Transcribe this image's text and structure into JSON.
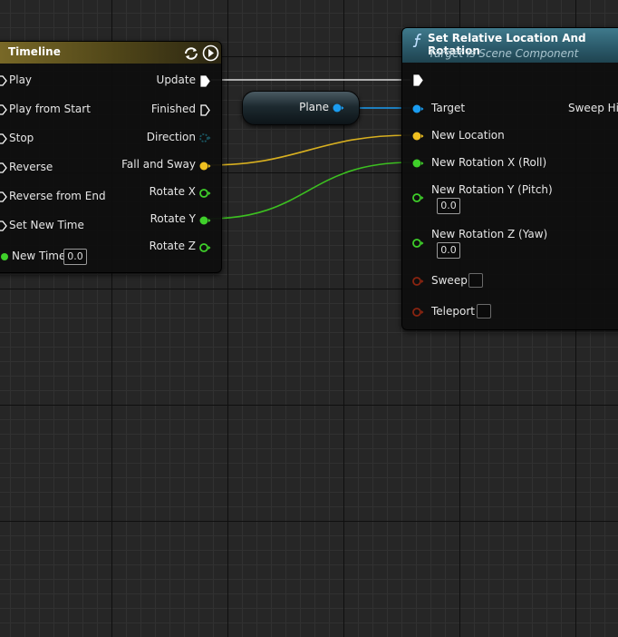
{
  "timeline": {
    "title": "Timeline",
    "inputs": [
      "Play",
      "Play from Start",
      "Stop",
      "Reverse",
      "Reverse from End",
      "Set New Time",
      "New Time"
    ],
    "new_time_value": "0.0",
    "outputs": [
      "Update",
      "Finished",
      "Direction",
      "Fall and Sway",
      "Rotate X",
      "Rotate Y",
      "Rotate Z"
    ],
    "header_color": "#6b5a1e"
  },
  "plane_node": {
    "label": "Plane"
  },
  "set_node": {
    "title": "Set Relative Location And Rotation",
    "subtitle": "Target is Scene Component",
    "function_icon": "function-icon",
    "header_color": "#2f5f6f",
    "inputs": {
      "target": "Target",
      "new_location": "New Location",
      "rot_x": "New Rotation X (Roll)",
      "rot_y": "New Rotation Y (Pitch)",
      "rot_y_value": "0.0",
      "rot_z": "New Rotation Z (Yaw)",
      "rot_z_value": "0.0",
      "sweep": "Sweep",
      "teleport": "Teleport"
    },
    "outputs": {
      "sweep_hit": "Sweep Hit"
    }
  },
  "colors": {
    "exec": "#ffffff",
    "object": "#1a9cf0",
    "vector": "#f0c020",
    "float": "#3fd02a",
    "bool": "#8a2410",
    "direction": "#1a5560"
  }
}
